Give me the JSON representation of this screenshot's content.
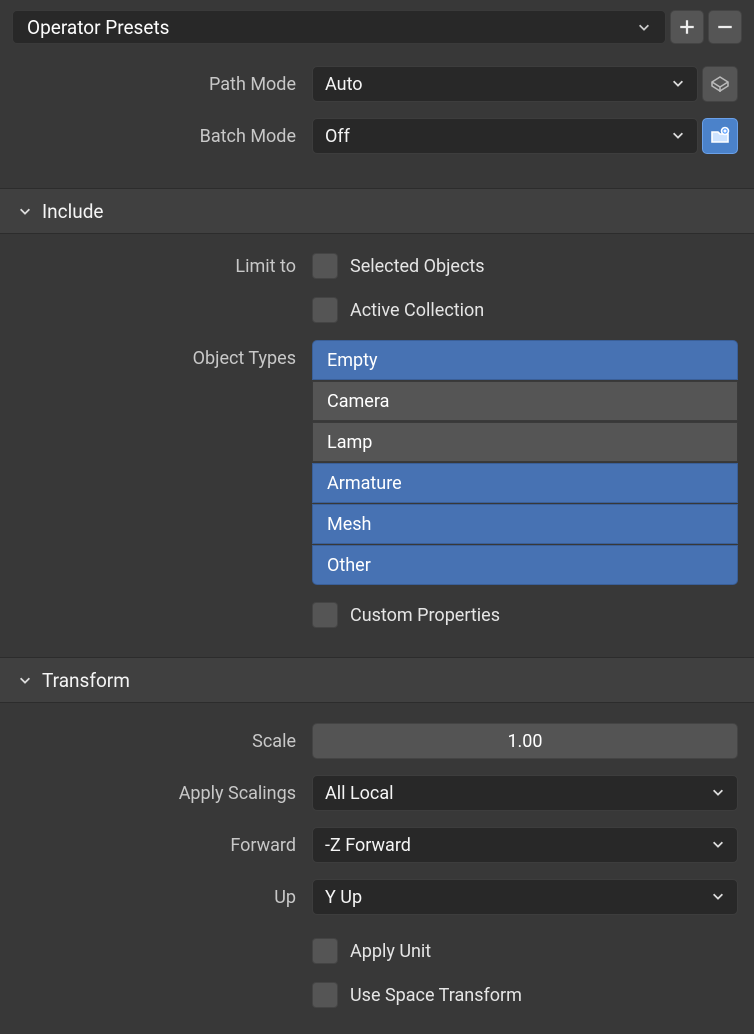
{
  "presets": {
    "label": "Operator Presets"
  },
  "top": {
    "path_mode": {
      "label": "Path Mode",
      "value": "Auto"
    },
    "batch_mode": {
      "label": "Batch Mode",
      "value": "Off"
    }
  },
  "include": {
    "title": "Include",
    "limit_to_label": "Limit to",
    "selected_objects": "Selected Objects",
    "active_collection": "Active Collection",
    "object_types_label": "Object Types",
    "types": [
      {
        "label": "Empty",
        "sel": true
      },
      {
        "label": "Camera",
        "sel": false
      },
      {
        "label": "Lamp",
        "sel": false
      },
      {
        "label": "Armature",
        "sel": true
      },
      {
        "label": "Mesh",
        "sel": true
      },
      {
        "label": "Other",
        "sel": true
      }
    ],
    "custom_properties": "Custom Properties"
  },
  "transform": {
    "title": "Transform",
    "scale_label": "Scale",
    "scale_value": "1.00",
    "apply_scalings_label": "Apply Scalings",
    "apply_scalings_value": "All Local",
    "forward_label": "Forward",
    "forward_value": "-Z Forward",
    "up_label": "Up",
    "up_value": "Y Up",
    "apply_unit": "Apply Unit",
    "use_space_transform": "Use Space Transform"
  }
}
